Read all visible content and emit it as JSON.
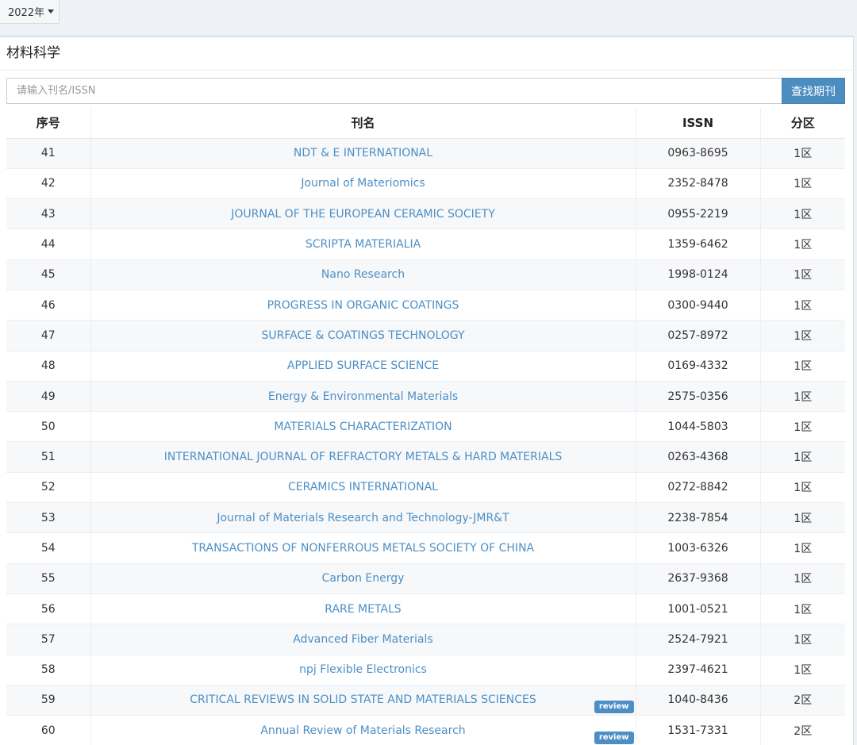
{
  "year_selector": {
    "label": "2022年"
  },
  "panel": {
    "title": "材料科学"
  },
  "search": {
    "placeholder": "请输入刊名/ISSN",
    "button_label": "查找期刊"
  },
  "table": {
    "headers": {
      "index": "序号",
      "name": "刊名",
      "issn": "ISSN",
      "zone": "分区"
    },
    "rows": [
      {
        "index": "41",
        "name": "NDT & E INTERNATIONAL",
        "issn": "0963-8695",
        "zone": "1区",
        "badge": ""
      },
      {
        "index": "42",
        "name": "Journal of Materiomics",
        "issn": "2352-8478",
        "zone": "1区",
        "badge": ""
      },
      {
        "index": "43",
        "name": "JOURNAL OF THE EUROPEAN CERAMIC SOCIETY",
        "issn": "0955-2219",
        "zone": "1区",
        "badge": ""
      },
      {
        "index": "44",
        "name": "SCRIPTA MATERIALIA",
        "issn": "1359-6462",
        "zone": "1区",
        "badge": ""
      },
      {
        "index": "45",
        "name": "Nano Research",
        "issn": "1998-0124",
        "zone": "1区",
        "badge": ""
      },
      {
        "index": "46",
        "name": "PROGRESS IN ORGANIC COATINGS",
        "issn": "0300-9440",
        "zone": "1区",
        "badge": ""
      },
      {
        "index": "47",
        "name": "SURFACE & COATINGS TECHNOLOGY",
        "issn": "0257-8972",
        "zone": "1区",
        "badge": ""
      },
      {
        "index": "48",
        "name": "APPLIED SURFACE SCIENCE",
        "issn": "0169-4332",
        "zone": "1区",
        "badge": ""
      },
      {
        "index": "49",
        "name": "Energy & Environmental Materials",
        "issn": "2575-0356",
        "zone": "1区",
        "badge": ""
      },
      {
        "index": "50",
        "name": "MATERIALS CHARACTERIZATION",
        "issn": "1044-5803",
        "zone": "1区",
        "badge": ""
      },
      {
        "index": "51",
        "name": "INTERNATIONAL JOURNAL OF REFRACTORY METALS & HARD MATERIALS",
        "issn": "0263-4368",
        "zone": "1区",
        "badge": ""
      },
      {
        "index": "52",
        "name": "CERAMICS INTERNATIONAL",
        "issn": "0272-8842",
        "zone": "1区",
        "badge": ""
      },
      {
        "index": "53",
        "name": "Journal of Materials Research and Technology-JMR&T",
        "issn": "2238-7854",
        "zone": "1区",
        "badge": ""
      },
      {
        "index": "54",
        "name": "TRANSACTIONS OF NONFERROUS METALS SOCIETY OF CHINA",
        "issn": "1003-6326",
        "zone": "1区",
        "badge": ""
      },
      {
        "index": "55",
        "name": "Carbon Energy",
        "issn": "2637-9368",
        "zone": "1区",
        "badge": ""
      },
      {
        "index": "56",
        "name": "RARE METALS",
        "issn": "1001-0521",
        "zone": "1区",
        "badge": ""
      },
      {
        "index": "57",
        "name": "Advanced Fiber Materials",
        "issn": "2524-7921",
        "zone": "1区",
        "badge": ""
      },
      {
        "index": "58",
        "name": "npj Flexible Electronics",
        "issn": "2397-4621",
        "zone": "1区",
        "badge": ""
      },
      {
        "index": "59",
        "name": "CRITICAL REVIEWS IN SOLID STATE AND MATERIALS SCIENCES",
        "issn": "1040-8436",
        "zone": "2区",
        "badge": "review"
      },
      {
        "index": "60",
        "name": "Annual Review of Materials Research",
        "issn": "1531-7331",
        "zone": "2区",
        "badge": "review"
      }
    ]
  }
}
